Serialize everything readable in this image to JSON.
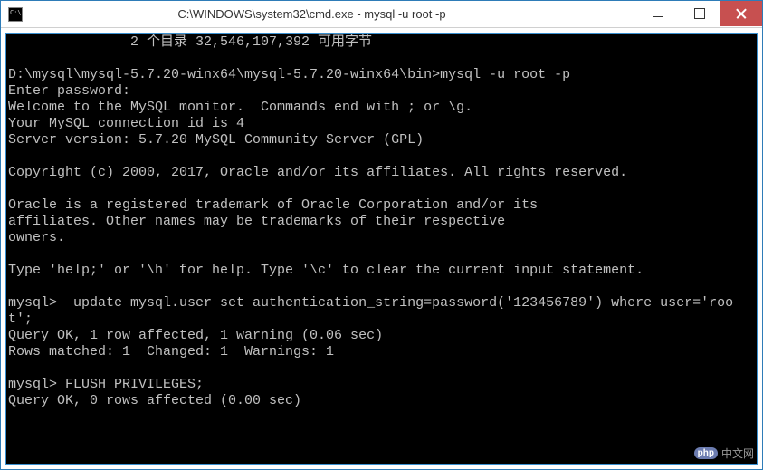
{
  "window": {
    "title": "C:\\WINDOWS\\system32\\cmd.exe - mysql  -u root -p"
  },
  "terminal": {
    "lines": [
      "               2 个目录 32,546,107,392 可用字节",
      "",
      "D:\\mysql\\mysql-5.7.20-winx64\\mysql-5.7.20-winx64\\bin>mysql -u root -p",
      "Enter password:",
      "Welcome to the MySQL monitor.  Commands end with ; or \\g.",
      "Your MySQL connection id is 4",
      "Server version: 5.7.20 MySQL Community Server (GPL)",
      "",
      "Copyright (c) 2000, 2017, Oracle and/or its affiliates. All rights reserved.",
      "",
      "Oracle is a registered trademark of Oracle Corporation and/or its",
      "affiliates. Other names may be trademarks of their respective",
      "owners.",
      "",
      "Type 'help;' or '\\h' for help. Type '\\c' to clear the current input statement.",
      "",
      "mysql>  update mysql.user set authentication_string=password('123456789') where user='root';",
      "Query OK, 1 row affected, 1 warning (0.06 sec)",
      "Rows matched: 1  Changed: 1  Warnings: 1",
      "",
      "mysql> FLUSH PRIVILEGES;",
      "Query OK, 0 rows affected (0.00 sec)"
    ]
  },
  "watermark": {
    "badge": "php",
    "text": "中文网"
  }
}
